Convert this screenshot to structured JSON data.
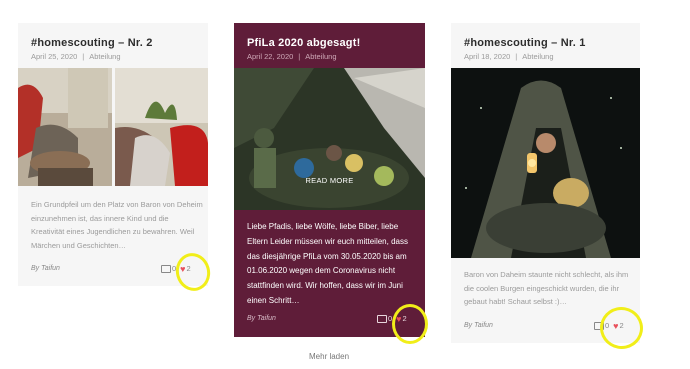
{
  "posts": [
    {
      "title": "#homescouting – Nr. 2",
      "date": "April 25, 2020",
      "category": "Abteilung",
      "excerpt": "Ein Grundpfeil um den Platz von Baron von Deheim einzunehmen ist, das innere Kind und die Kreativität eines Jugendlichen zu bewahren. Weil Märchen und Geschichten…",
      "by": "By",
      "author": "Taifun",
      "comments": "0",
      "likes": "2"
    },
    {
      "title": "PfiLa 2020 abgesagt!",
      "date": "April 22, 2020",
      "category": "Abteilung",
      "overlay": "READ MORE",
      "excerpt": "Liebe Pfadis, liebe Wölfe, liebe Biber, liebe Eltern Leider müssen wir euch mitteilen, dass das diesjährige PfiLa vom 30.05.2020 bis am 01.06.2020 wegen dem Coronavirus nicht stattfinden wird. Wir hoffen, dass wir im Juni einen Schritt…",
      "by": "By",
      "author": "Taifun",
      "comments": "0",
      "likes": "2"
    },
    {
      "title": "#homescouting – Nr. 1",
      "date": "April 18, 2020",
      "category": "Abteilung",
      "excerpt": "Baron von Daheim staunte nicht schlecht, als ihm die coolen Burgen eingeschickt wurden, die ihr gebaut habt! Schaut selbst :)…",
      "by": "By",
      "author": "Taifun",
      "comments": "0",
      "likes": "2"
    }
  ],
  "load_more": "Mehr laden",
  "colors": {
    "highlight": "#f1ee19",
    "featured_bg": "#5f1d39",
    "heart": "#e8505b"
  }
}
